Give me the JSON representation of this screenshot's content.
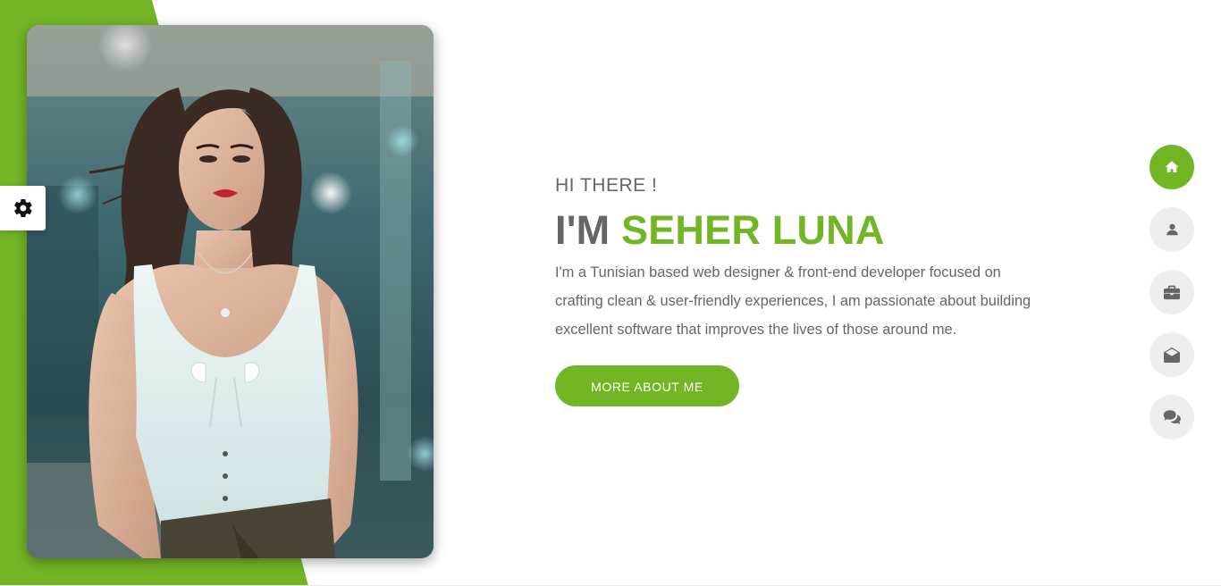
{
  "colors": {
    "accent": "#72b626",
    "text": "#666666",
    "nav_inactive_bg": "#eeeeee",
    "icon_inactive": "#666666",
    "icon_active": "#ffffff"
  },
  "hero": {
    "photo": "woman in white top portrait",
    "greeting": "HI THERE !",
    "headline_prefix": "I'M",
    "headline_name": "SEHER LUNA",
    "bio": "I'm a Tunisian based web designer & front-end developer focused on crafting clean & user-friendly experiences, I am passionate about building excellent software that improves the lives of those around me.",
    "cta_label": "MORE ABOUT ME"
  },
  "settings": {
    "icon": "gear-icon"
  },
  "nav": {
    "items": [
      {
        "icon": "home-icon",
        "active": true
      },
      {
        "icon": "user-icon",
        "active": false
      },
      {
        "icon": "briefcase-icon",
        "active": false
      },
      {
        "icon": "envelope-open-icon",
        "active": false
      },
      {
        "icon": "comments-icon",
        "active": false
      }
    ]
  }
}
